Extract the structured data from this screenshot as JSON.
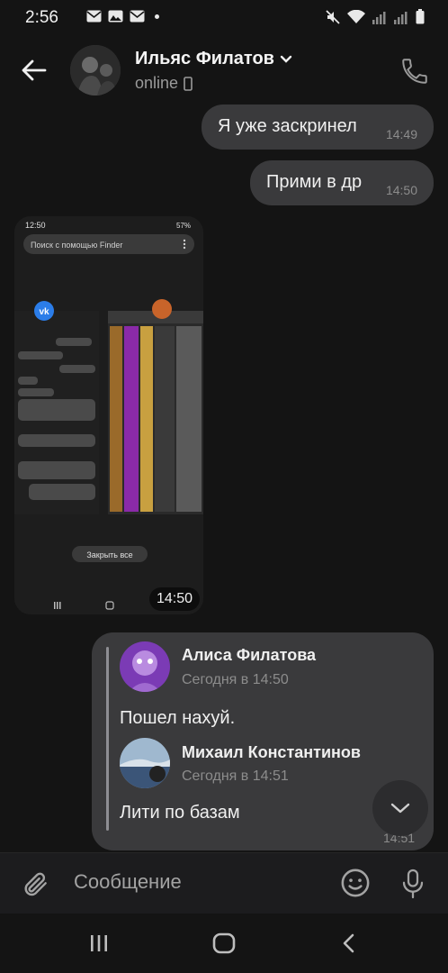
{
  "status_bar": {
    "time": "2:56"
  },
  "header": {
    "contact_name": "Ильяс Филатов",
    "status": "online"
  },
  "messages": [
    {
      "text": "Я уже заскринел",
      "time": "14:49"
    },
    {
      "text": "Прими в др",
      "time": "14:50"
    }
  ],
  "photo_message": {
    "time": "14:50",
    "screenshot": {
      "time": "12:50",
      "battery": "57%",
      "search_placeholder": "Поиск с помощью Finder",
      "close_all": "Закрыть все"
    }
  },
  "forwarded_message": {
    "first": {
      "author": "Алиса Филатова",
      "date": "Сегодня в 14:50",
      "text": "Пошел нахуй."
    },
    "second": {
      "author": "Михаил Константинов",
      "date": "Сегодня в 14:51",
      "text": "Лити по базам"
    },
    "time": "14:51"
  },
  "composer": {
    "placeholder": "Сообщение"
  },
  "colors": {
    "background": "#141414",
    "bubble": "#3a3a3c",
    "meta": "#8c8c8c"
  }
}
